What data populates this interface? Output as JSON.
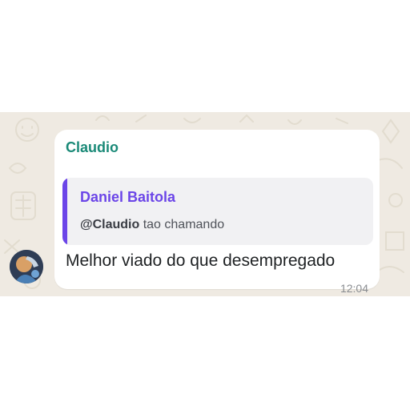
{
  "chat": {
    "sender_name": "Claudio",
    "quoted": {
      "author": "Daniel Baitola",
      "mention": "@Claudio",
      "text": " tao chamando"
    },
    "message_text": "Melhor viado do que desempregado",
    "timestamp": "12:04"
  },
  "colors": {
    "sender": "#1b8a78",
    "quote_accent": "#6b45e8",
    "wallpaper": "#efeae2",
    "bubble": "#ffffff",
    "quote_bg": "#f1f1f3"
  },
  "icons": [
    "avatar"
  ]
}
